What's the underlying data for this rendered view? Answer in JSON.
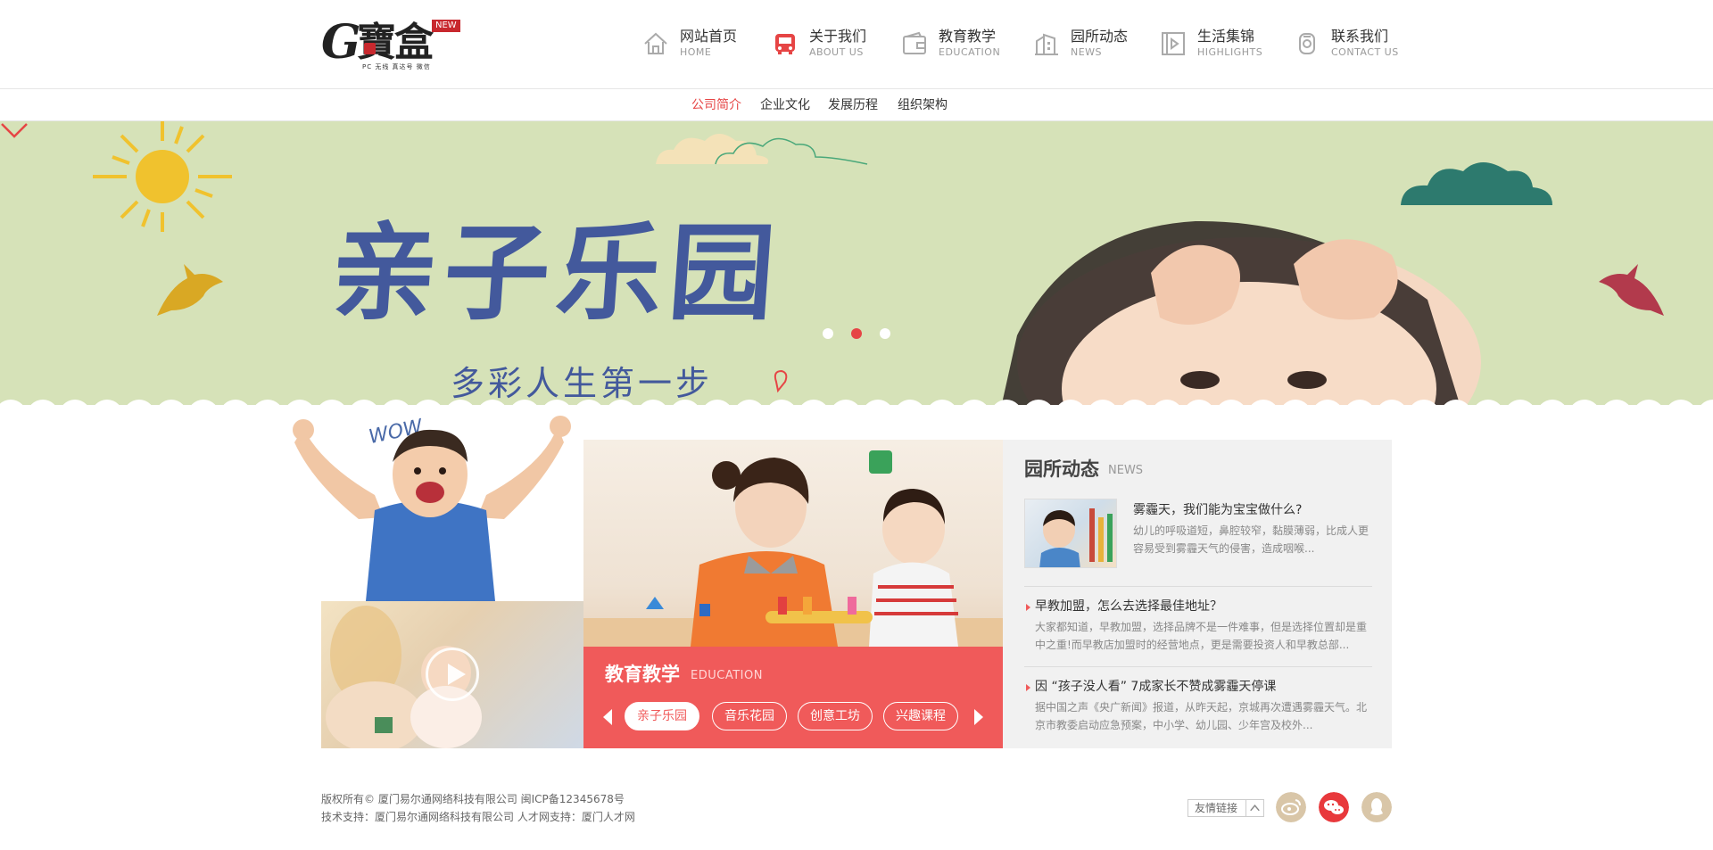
{
  "logo": {
    "main": "寶盒",
    "letter": "G",
    "badge": "NEW",
    "tagline": "PC 无线 真达号 微信"
  },
  "nav": [
    {
      "zh": "网站首页",
      "en": "HOME",
      "icon": "home-icon"
    },
    {
      "zh": "关于我们",
      "en": "ABOUT US",
      "icon": "bus-icon"
    },
    {
      "zh": "教育教学",
      "en": "EDUCATION",
      "icon": "wallet-icon"
    },
    {
      "zh": "园所动态",
      "en": "NEWS",
      "icon": "building-icon"
    },
    {
      "zh": "生活集锦",
      "en": "HIGHLIGHTS",
      "icon": "film-icon"
    },
    {
      "zh": "联系我们",
      "en": "CONTACT US",
      "icon": "phone-icon"
    }
  ],
  "subnav": [
    "公司简介",
    "企业文化",
    "发展历程",
    "组织架构"
  ],
  "subnav_active": 0,
  "banner": {
    "title": "亲子乐园",
    "subtitle": "多彩人生第一步",
    "wow": "WOW",
    "active_slide": 1,
    "slide_count": 3,
    "colors": {
      "bg": "#d6e2b8",
      "sun": "#f0c22e",
      "cloud_dark": "#2d7a6e",
      "title": "#43599c"
    }
  },
  "education": {
    "title": "教育教学",
    "title_en": "EDUCATION",
    "tabs": [
      "亲子乐园",
      "音乐花园",
      "创意工坊",
      "兴趣课程"
    ],
    "active_tab": 0,
    "color": "#f05a5a"
  },
  "news": {
    "title": "园所动态",
    "title_en": "NEWS",
    "items": [
      {
        "title": "雾霾天，我们能为宝宝做什么?",
        "summary": "幼儿的呼吸道短，鼻腔较窄，黏膜薄弱，比成人更容易受到雾霾天气的侵害，造成咽喉..."
      },
      {
        "title": "早教加盟，怎么去选择最佳地址？",
        "summary": "大家都知道，早教加盟，选择品牌不是一件难事，但是选择位置却是重中之重!而早教店加盟时的经营地点，更是需要投资人和早教总部..."
      },
      {
        "title": "因 “孩子没人看” 7成家长不赞成雾霾天停课",
        "summary": "据中国之声《央广新闻》报道，从昨天起，京城再次遭遇雾霾天气。北京市教委启动应急预案，中小学、幼儿园、少年宫及校外..."
      }
    ]
  },
  "footer": {
    "line1": "版权所有© 厦门易尔通网络科技有限公司   闽ICP备12345678号",
    "line2": "技术支持：厦门易尔通网络科技有限公司   人才网支持：厦门人才网",
    "friend_links": "友情链接",
    "social": [
      {
        "name": "weibo-icon",
        "color": "#d9c6a8"
      },
      {
        "name": "wechat-icon",
        "color": "#e8393c"
      },
      {
        "name": "qq-icon",
        "color": "#d9c6a8"
      }
    ]
  }
}
